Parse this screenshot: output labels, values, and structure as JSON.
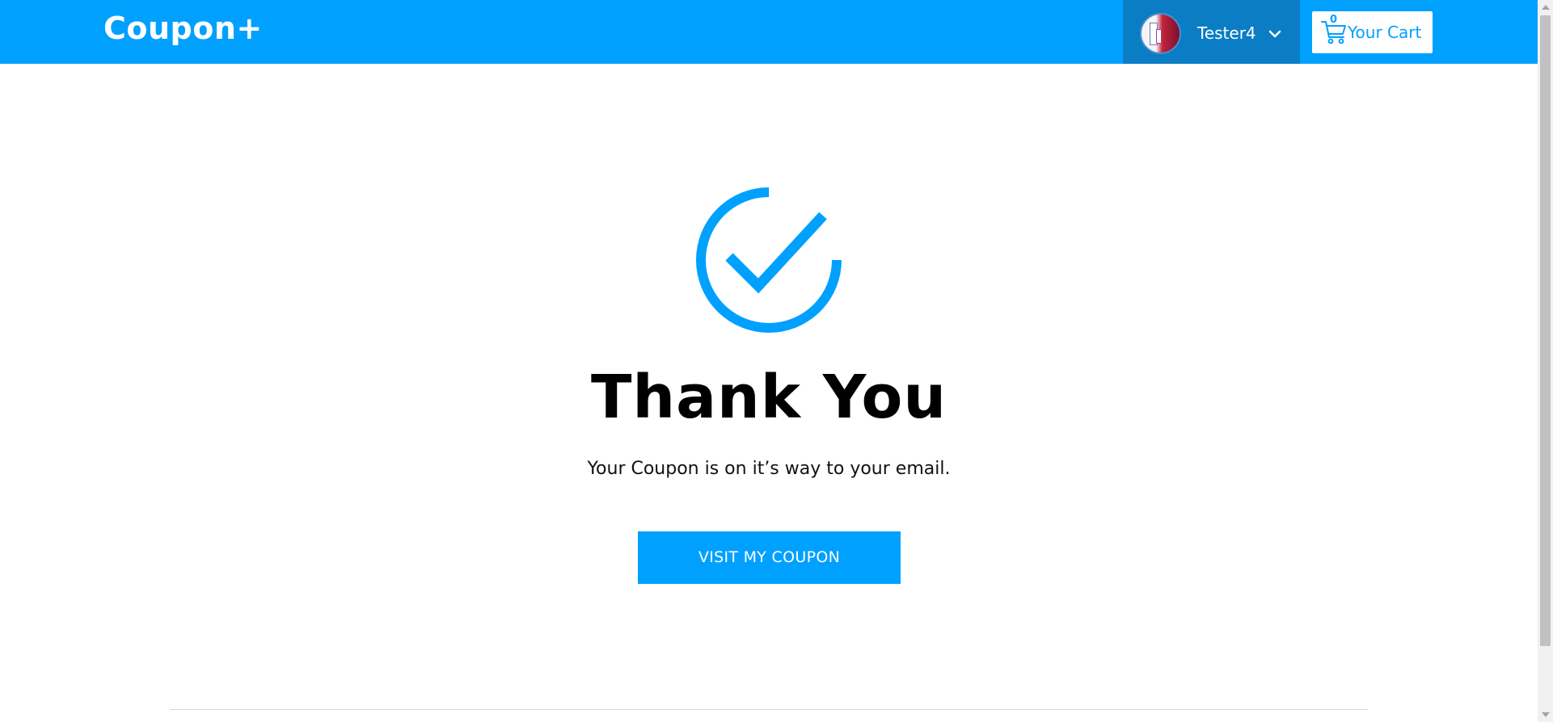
{
  "header": {
    "logo": "Coupon+",
    "user": {
      "name": "Tester4",
      "menu_icon": "chevron-down-icon"
    },
    "cart": {
      "count": "0",
      "label": "Your Cart",
      "icon": "cart-icon"
    }
  },
  "main": {
    "status_icon": "check-circle-icon",
    "title": "Thank You",
    "message": "Your Coupon is on it’s way to your email.",
    "button_label": "VISIT MY COUPON"
  },
  "colors": {
    "primary": "#00a1fe",
    "user_menu_bg": "#0a7dc4",
    "text": "#000000"
  }
}
